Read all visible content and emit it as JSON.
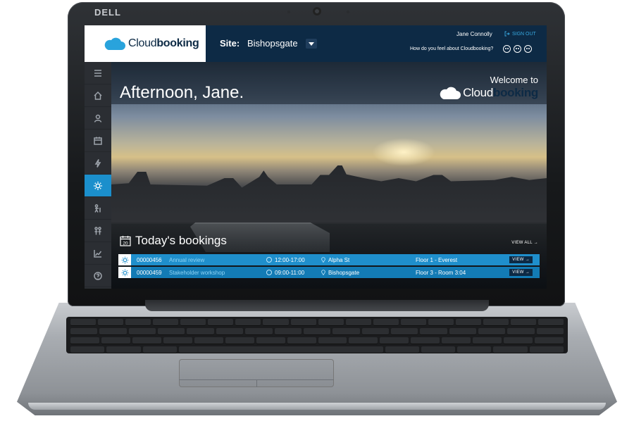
{
  "device": {
    "brand": "DELL"
  },
  "header": {
    "logo_text_light": "Cloud",
    "logo_text_bold": "booking",
    "site_label": "Site:",
    "site_value": "Bishopsgate",
    "user_name": "Jane Connolly",
    "signout_label": "SIGN OUT",
    "feedback_question": "How do you feel about Cloudbooking?"
  },
  "sidebar": {
    "items": [
      {
        "icon": "menu-icon"
      },
      {
        "icon": "home-icon"
      },
      {
        "icon": "user-icon"
      },
      {
        "icon": "calendar-icon"
      },
      {
        "icon": "lightning-icon"
      },
      {
        "icon": "sun-icon",
        "active": true
      },
      {
        "icon": "visitors-icon"
      },
      {
        "icon": "people-icon"
      },
      {
        "icon": "analytics-icon"
      },
      {
        "icon": "help-icon"
      }
    ]
  },
  "hero": {
    "greeting": "Afternoon, Jane.",
    "welcome_to": "Welcome to",
    "welcome_logo_light": "Cloud",
    "welcome_logo_bold": "booking"
  },
  "bookings": {
    "title": "Today's bookings",
    "calendar_day": "20",
    "view_all": "VIEW ALL →",
    "rows": [
      {
        "id": "00000456",
        "name": "Annual review",
        "time": "12:00-17:00",
        "site": "Alpha St",
        "room": "Floor 1 - Everest",
        "view": "VIEW →"
      },
      {
        "id": "00000459",
        "name": "Stakeholder workshop",
        "time": "09:00-11:00",
        "site": "Bishopsgate",
        "room": "Floor 3 - Room 3:04",
        "view": "VIEW →"
      }
    ]
  },
  "colors": {
    "navy": "#0d2a45",
    "accent": "#1f8fcc",
    "sidebar": "#2b2e33"
  }
}
